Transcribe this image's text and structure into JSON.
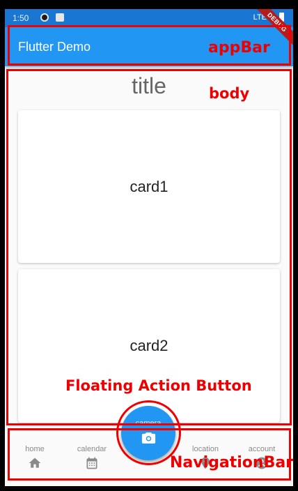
{
  "status_bar": {
    "time": "1:50",
    "network": "LTE"
  },
  "app_bar": {
    "title": "Flutter Demo",
    "debug_banner": "DEBUG"
  },
  "body": {
    "title": "title",
    "cards": [
      "card1",
      "card2"
    ]
  },
  "fab": {
    "label": "camera",
    "icon": "camera-icon"
  },
  "navigation_bar": {
    "items": [
      {
        "label": "home",
        "icon": "home-icon"
      },
      {
        "label": "calendar",
        "icon": "calendar-icon"
      },
      {
        "label": "location",
        "icon": "location-icon"
      },
      {
        "label": "account",
        "icon": "account-icon"
      }
    ]
  },
  "annotations": {
    "app_bar": "appBar",
    "body": "body",
    "fab": "Floating Action Button",
    "navigation_bar": "NavigationBar"
  },
  "colors": {
    "primary": "#2196f3",
    "status_bar": "#1976d2",
    "annotation": "#ee0000"
  }
}
